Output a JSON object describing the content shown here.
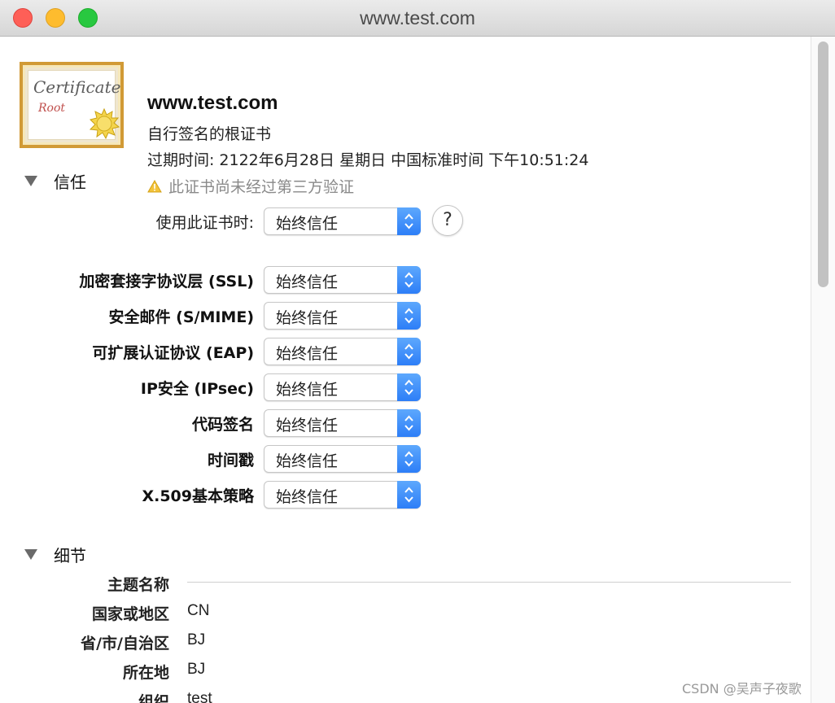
{
  "window": {
    "title": "www.test.com",
    "traffic_lights": [
      "close",
      "minimize",
      "zoom"
    ]
  },
  "certificate": {
    "icon_text": "Certificate",
    "icon_subtext": "Root",
    "name": "www.test.com",
    "description": "自行签名的根证书",
    "expiry_label": "过期时间:",
    "expiry_value": "2122年6月28日 星期日 中国标准时间 下午10:51:24",
    "warning": "此证书尚未经过第三方验证"
  },
  "trust": {
    "title": "信任",
    "when_using_label": "使用此证书时:",
    "when_using_value": "始终信任",
    "help_label": "?",
    "rows": [
      {
        "label": "加密套接字协议层 (SSL)",
        "value": "始终信任"
      },
      {
        "label": "安全邮件 (S/MIME)",
        "value": "始终信任"
      },
      {
        "label": "可扩展认证协议 (EAP)",
        "value": "始终信任"
      },
      {
        "label": "IP安全 (IPsec)",
        "value": "始终信任"
      },
      {
        "label": "代码签名",
        "value": "始终信任"
      },
      {
        "label": "时间戳",
        "value": "始终信任"
      },
      {
        "label": "X.509基本策略",
        "value": "始终信任"
      }
    ]
  },
  "details": {
    "title": "细节",
    "subject_name_label": "主题名称",
    "rows": [
      {
        "label": "国家或地区",
        "value": "CN"
      },
      {
        "label": "省/市/自治区",
        "value": "BJ"
      },
      {
        "label": "所在地",
        "value": "BJ"
      },
      {
        "label": "组织",
        "value": "test"
      }
    ]
  },
  "watermark": "CSDN @吴声子夜歌",
  "colors": {
    "accent": "#2d7ef7",
    "warning": "#f3c33a",
    "close": "#fe5f57",
    "minimize": "#febc2e",
    "zoom": "#28c840"
  }
}
